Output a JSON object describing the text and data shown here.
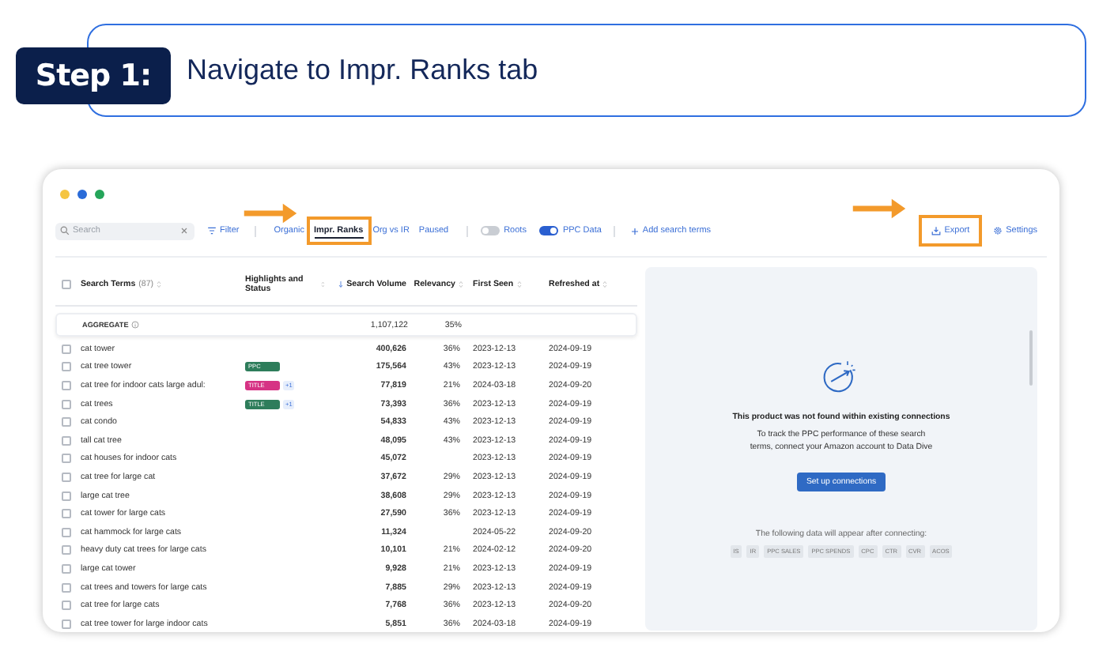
{
  "step": {
    "badge": "Step 1:",
    "instruction": "Navigate to Impr. Ranks tab"
  },
  "toolbar": {
    "search": {
      "placeholder": "Search"
    },
    "filter": "Filter",
    "tabs": [
      {
        "label": "Organic",
        "selected": false,
        "highlighted": false
      },
      {
        "label": "Impr. Ranks",
        "selected": true,
        "highlighted": true
      },
      {
        "label": "Org vs IR",
        "selected": false,
        "highlighted": false
      },
      {
        "label": "Paused",
        "selected": false,
        "highlighted": false
      }
    ],
    "toggles": [
      {
        "label": "Roots",
        "on": false
      },
      {
        "label": "PPC Data",
        "on": true
      }
    ],
    "add_terms": "Add search terms",
    "export": {
      "label": "Export",
      "highlighted": true
    },
    "settings": "Settings"
  },
  "table": {
    "select_all": {
      "checked": false
    },
    "columns": [
      {
        "label": "Search Terms",
        "count": "(87)",
        "sorted": false
      },
      {
        "label": "Highlights and Status",
        "sorted": false
      },
      {
        "label": "Search Volume",
        "sorted": true
      },
      {
        "label": "Relevancy",
        "sorted": false
      },
      {
        "label": "First Seen",
        "sorted": false
      },
      {
        "label": "Refreshed at",
        "sorted": false
      }
    ],
    "aggregate": {
      "label": "AGGREGATE",
      "volume": "1,107,122",
      "relevancy": "35%"
    },
    "rows": [
      {
        "checked": false,
        "term": "cat tower",
        "volume": "400,626",
        "relevancy": "36%",
        "first_seen": "2023-12-13",
        "refreshed": "2024-09-19"
      },
      {
        "checked": false,
        "term": "cat tree tower",
        "tags": [
          {
            "label": "PPC",
            "color": "#2e7d5b"
          }
        ],
        "volume": "175,564",
        "relevancy": "43%",
        "first_seen": "2023-12-13",
        "refreshed": "2024-09-19"
      },
      {
        "checked": false,
        "term": "cat tree for indoor cats large adul:",
        "tags": [
          {
            "label": "TITLE",
            "color": "#d63384"
          }
        ],
        "more": "+1",
        "volume": "77,819",
        "relevancy": "21%",
        "first_seen": "2024-03-18",
        "refreshed": "2024-09-20"
      },
      {
        "checked": false,
        "term": "cat trees",
        "tags": [
          {
            "label": "TITLE",
            "color": "#2e7d5b"
          }
        ],
        "more": "+1",
        "volume": "73,393",
        "relevancy": "36%",
        "first_seen": "2023-12-13",
        "refreshed": "2024-09-19"
      },
      {
        "checked": false,
        "term": "cat condo",
        "volume": "54,833",
        "relevancy": "43%",
        "first_seen": "2023-12-13",
        "refreshed": "2024-09-19"
      },
      {
        "checked": false,
        "term": "tall cat tree",
        "volume": "48,095",
        "relevancy": "43%",
        "first_seen": "2023-12-13",
        "refreshed": "2024-09-19"
      },
      {
        "checked": false,
        "term": "cat houses for indoor cats",
        "volume": "45,072",
        "first_seen": "2023-12-13",
        "refreshed": "2024-09-19"
      },
      {
        "checked": false,
        "term": "cat tree for large cat",
        "volume": "37,672",
        "relevancy": "29%",
        "first_seen": "2023-12-13",
        "refreshed": "2024-09-19"
      },
      {
        "checked": false,
        "term": "large cat tree",
        "volume": "38,608",
        "relevancy": "29%",
        "first_seen": "2023-12-13",
        "refreshed": "2024-09-19"
      },
      {
        "checked": false,
        "term": "cat tower for large cats",
        "volume": "27,590",
        "relevancy": "36%",
        "first_seen": "2023-12-13",
        "refreshed": "2024-09-19"
      },
      {
        "checked": false,
        "term": "cat hammock for large cats",
        "volume": "11,324",
        "first_seen": "2024-05-22",
        "refreshed": "2024-09-20"
      },
      {
        "checked": false,
        "term": "heavy duty cat trees for large cats",
        "volume": "10,101",
        "relevancy": "21%",
        "first_seen": "2024-02-12",
        "refreshed": "2024-09-20"
      },
      {
        "checked": false,
        "term": "large cat tower",
        "volume": "9,928",
        "relevancy": "21%",
        "first_seen": "2023-12-13",
        "refreshed": "2024-09-19"
      },
      {
        "checked": false,
        "term": "cat trees and towers for large cats",
        "volume": "7,885",
        "relevancy": "29%",
        "first_seen": "2023-12-13",
        "refreshed": "2024-09-19"
      },
      {
        "checked": false,
        "term": "cat tree for large cats",
        "volume": "7,768",
        "relevancy": "36%",
        "first_seen": "2023-12-13",
        "refreshed": "2024-09-20"
      },
      {
        "checked": false,
        "term": "cat tree tower for large indoor cats",
        "volume": "5,851",
        "relevancy": "36%",
        "first_seen": "2024-03-18",
        "refreshed": "2024-09-19"
      }
    ]
  },
  "panel": {
    "title": "This product was not found within existing connections",
    "description": "To track the PPC performance of these search terms, connect your Amazon account to Data Dive",
    "button": "Set up connections",
    "note": "The following data will appear after connecting:",
    "metrics": [
      "IS",
      "IR",
      "PPC SALES",
      "PPC SPENDS",
      "CPC",
      "CTR",
      "CVR",
      "ACOS"
    ]
  }
}
